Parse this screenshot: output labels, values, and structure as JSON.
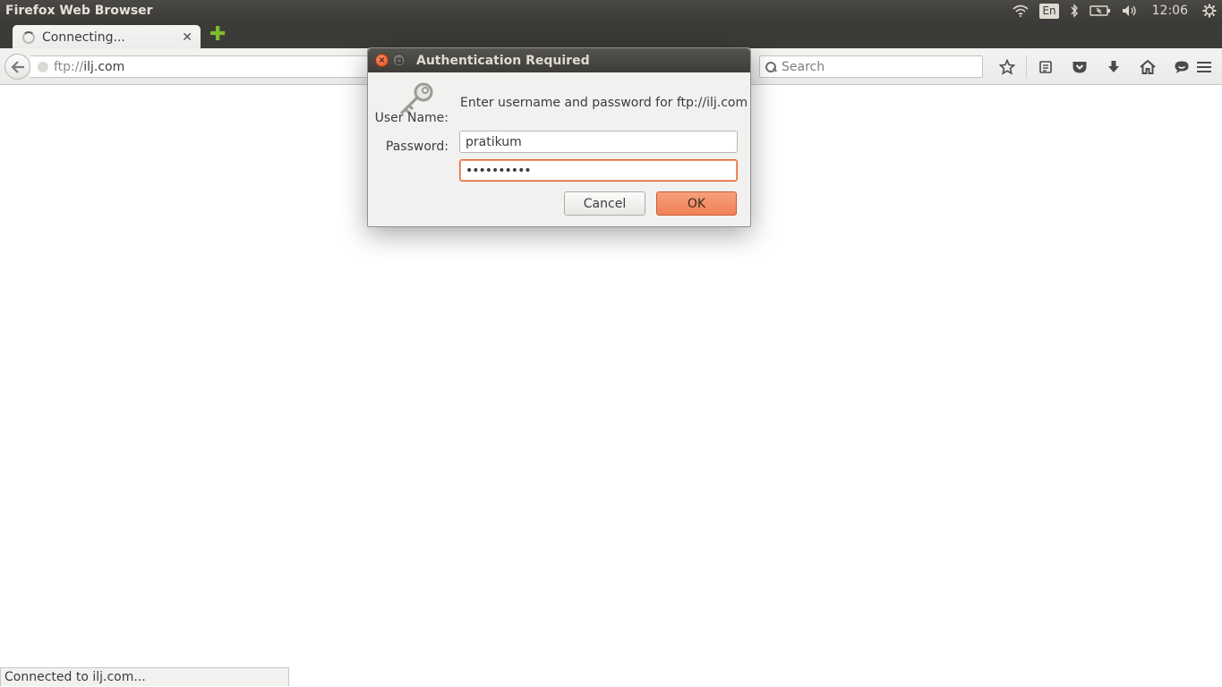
{
  "panel": {
    "app_title": "Firefox Web Browser",
    "keyboard_layout": "En",
    "clock": "12:06",
    "indicators": [
      "wifi-icon",
      "bluetooth-icon",
      "battery-icon",
      "volume-icon",
      "settings-gear-icon"
    ]
  },
  "tabs": [
    {
      "label": "Connecting...",
      "loading": true
    }
  ],
  "navbar": {
    "url_scheme": "ftp://",
    "url_host": "ilj.com",
    "search_placeholder": "Search",
    "toolbar_icons": [
      "bookmark-star-icon",
      "reading-list-icon",
      "pocket-icon",
      "downloads-icon",
      "home-icon",
      "chat-icon",
      "menu-icon"
    ]
  },
  "dialog": {
    "title": "Authentication Required",
    "message": "Enter username and password for ftp://ilj.com",
    "username_label": "User Name:",
    "username_value": "pratikum",
    "password_label": "Password:",
    "password_value": "••••••••••",
    "cancel_label": "Cancel",
    "ok_label": "OK"
  },
  "status": {
    "text": "Connected to ilj.com..."
  },
  "colors": {
    "panel_bg": "#3c3b37",
    "accent_orange": "#f08156",
    "dialog_bg": "#f2f1f0"
  }
}
